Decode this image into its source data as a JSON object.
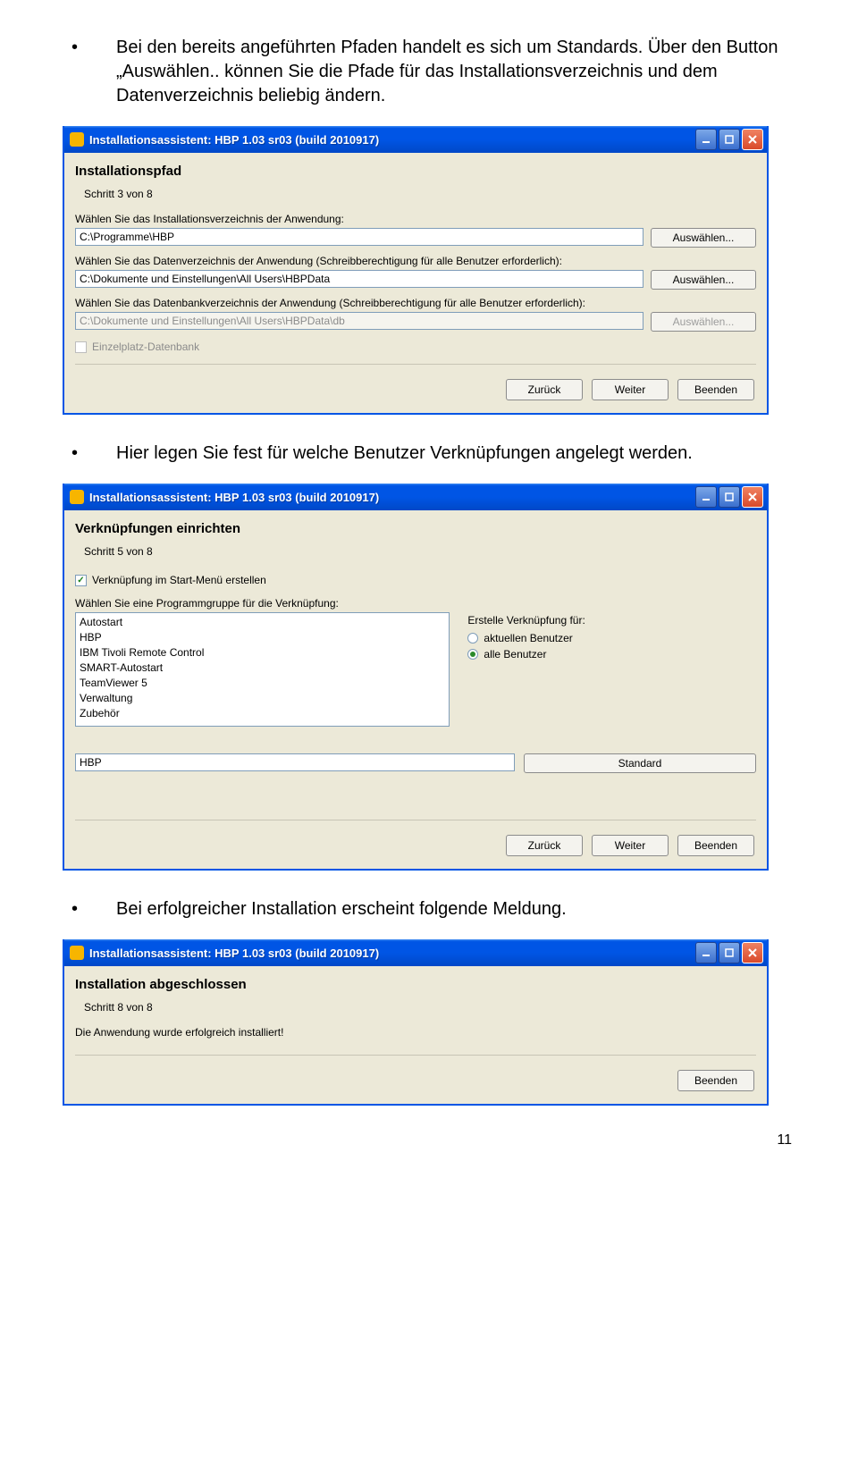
{
  "bullets": {
    "b1": "Bei den bereits angeführten Pfaden handelt es sich um Standards. Über den Button „Auswählen.. können Sie die Pfade für das Installationsverzeichnis und dem Datenverzeichnis beliebig ändern.",
    "b2": "Hier legen Sie fest für welche Benutzer Verknüpfungen angelegt werden.",
    "b3": "Bei erfolgreicher Installation erscheint folgende Meldung."
  },
  "common": {
    "title": "Installationsassistent: HBP 1.03 sr03 (build 2010917)",
    "btn_back": "Zurück",
    "btn_next": "Weiter",
    "btn_quit": "Beenden",
    "btn_browse": "Auswählen..."
  },
  "dlg1": {
    "heading": "Installationspfad",
    "step": "Schritt 3 von 8",
    "label1": "Wählen Sie das Installationsverzeichnis der Anwendung:",
    "path1": "C:\\Programme\\HBP",
    "label2": "Wählen Sie das Datenverzeichnis der Anwendung (Schreibberechtigung für alle Benutzer erforderlich):",
    "path2": "C:\\Dokumente und Einstellungen\\All Users\\HBPData",
    "label3": "Wählen Sie das Datenbankverzeichnis der Anwendung  (Schreibberechtigung für alle Benutzer erforderlich):",
    "path3": "C:\\Dokumente und Einstellungen\\All Users\\HBPData\\db",
    "chk_label": "Einzelplatz-Datenbank"
  },
  "dlg2": {
    "heading": "Verknüpfungen einrichten",
    "step": "Schritt 5 von 8",
    "chk_label": "Verknüpfung im Start-Menü erstellen",
    "group_label": "Wählen Sie eine Programmgruppe für die Verknüpfung:",
    "items": [
      "Autostart",
      "HBP",
      "IBM Tivoli Remote Control",
      "SMART-Autostart",
      "TeamViewer 5",
      "Verwaltung",
      "Zubehör"
    ],
    "radio_title": "Erstelle Verknüpfung für:",
    "radio1": "aktuellen Benutzer",
    "radio2": "alle Benutzer",
    "current_group": "HBP",
    "btn_default": "Standard"
  },
  "dlg3": {
    "heading": "Installation abgeschlossen",
    "step": "Schritt 8 von 8",
    "msg": "Die Anwendung wurde erfolgreich installiert!"
  },
  "page_num": "11"
}
